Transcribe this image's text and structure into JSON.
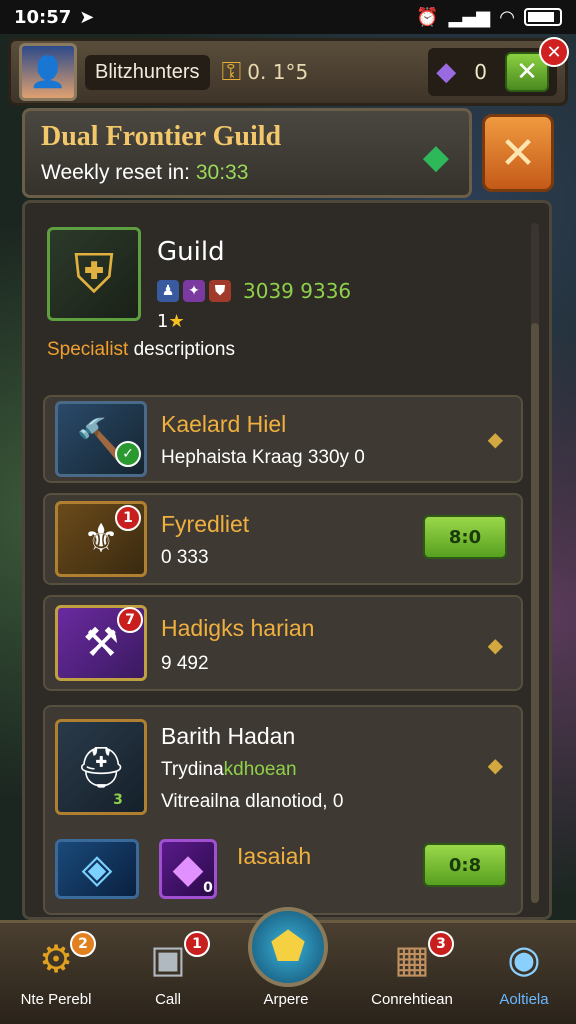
{
  "status_bar": {
    "time": "10:57",
    "network_icon": "signal-icon",
    "wifi_icon": "wifi-icon",
    "battery_icon": "battery-icon"
  },
  "top_bar": {
    "player_name": "Blitzhunters",
    "gold_value": "0. 1°5",
    "gem_value": "0",
    "plus_label": "✕",
    "close_label": "✕"
  },
  "guild_header": {
    "title": "Dual Frontier Guild",
    "subtitle_white": "Weekly reset in: ",
    "subtitle_green": "30:33",
    "close_label": "✕"
  },
  "guild": {
    "name": "Guild",
    "stats": "3039 9336",
    "rank": "1",
    "rank_star": "★",
    "desc_orange": "Specialist",
    "desc_white": " descriptions"
  },
  "items": [
    {
      "title": "Kaelard Hiel",
      "subtitle": "Hephaista Kraag 330y 0",
      "badge": "✓",
      "action": ""
    },
    {
      "title": "Fyredliet",
      "subtitle": "0 333",
      "badge": "1",
      "action": "8:0"
    },
    {
      "title": "Hadigks harian",
      "subtitle": "9 492",
      "badge": "7",
      "action": ""
    },
    {
      "title": "Barith Hadan",
      "subtitle_white": "Trydina",
      "subtitle_green": "kdhoean",
      "subtitle2": "Vitreailna dlanotiod, 0",
      "badge": "3",
      "action": ""
    },
    {
      "title": "Iasaiah",
      "badge": "0",
      "action": "0:8"
    }
  ],
  "bottom_nav": [
    {
      "label": "Nte Perebl",
      "badge": "2"
    },
    {
      "label": "Call",
      "badge": "1"
    },
    {
      "label": "Arpere",
      "badge": ""
    },
    {
      "label": "Conrehtiean",
      "badge": "3"
    },
    {
      "label": "Aoltiela",
      "badge": ""
    }
  ],
  "colors": {
    "accent_gold": "#f0b040",
    "accent_green": "#8ed04a",
    "close_orange": "#e07a28"
  }
}
